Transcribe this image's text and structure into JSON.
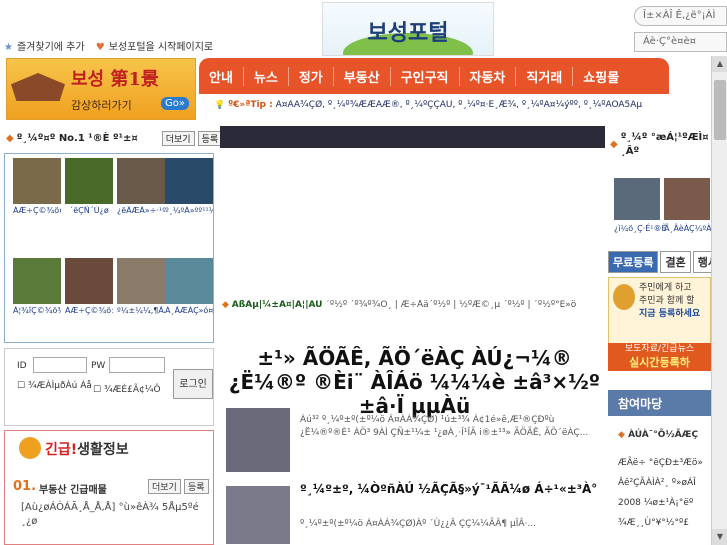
{
  "favorites": {
    "add_favorite": "즐겨찾기에 추가",
    "set_homepage": "보성포털을 시작페이지로"
  },
  "logo": {
    "text": "보성포털"
  },
  "top_right": {
    "box1": "Î±×ÀÎ Ê,¿ë°¡ÀÌ",
    "box2": "Áè·Ç°è¤è¤"
  },
  "banner": {
    "title": "보성 第1景",
    "sub": "감상하러가기",
    "go": "Go»"
  },
  "nav": {
    "items": [
      "안내",
      "뉴스",
      "정가",
      "부동산",
      "구인구직",
      "자동차",
      "직거래",
      "쇼핑몰"
    ]
  },
  "tipbar": {
    "label": "º€»ªTip :",
    "text": "Á¤ÀÃ¾ÇØ, º¸¼º¾ÆÆÀÆ®, º¸¼ºÇÇÀÚ, º¸¼º¤·È¸Æ¾, º¸¼ºÃ¤¼ýºº, º¸¼ºÃÖÃ5Âµ"
  },
  "photo_section": {
    "title": "º¸¼º¤º No.1 ¹®È º¹±¤",
    "more": "더보기",
    "register": "등록",
    "photos": [
      {
        "caption": "ÀÆ÷Ç©¾ö¤ºÀÂ±×Ç©¾ö",
        "color": "#7a6a4a"
      },
      {
        "caption": "´ëÇÑ´Ù¿ø",
        "color": "#4a6a2a"
      },
      {
        "caption": "¿ëÃÆÀ»÷·¹ºÎ",
        "color": "#6a5a4a"
      },
      {
        "caption": "º¸¼ºÀ»ºº¹¹¼ú¹Ù",
        "color": "#2a4a6a"
      },
      {
        "caption": "Á¦¾îÇ©¾ö¾î¾Ñ³,²",
        "color": "#5a7a3a"
      },
      {
        "caption": "ÀÆ÷Ç©¾ö±ÃÀÂÂ³Î",
        "color": "#6a4a3a"
      },
      {
        "caption": "º¼±¼¼,¶ÃÁ¾Í»·Þ¿¬",
        "color": "#8a7a6a"
      },
      {
        "caption": "Á¸ÃÆÀÇ»ó¤º¾",
        "color": "#5a8a9a"
      }
    ]
  },
  "login": {
    "id_label": "ID",
    "pw_label": "PW",
    "login_btn": "로그인",
    "save_id": "¾ÆÀÌµðÀú Àå",
    "save_pw": "¾ÆÈ£Ã¢¼Ô"
  },
  "urgent": {
    "title_red": "긴급!",
    "title_black": "생활정보",
    "num": "01.",
    "item1": "부동산 긴급매물",
    "more": "더보기",
    "register": "등록",
    "item2": "[Aù¿øÁÒÁÃ¸Å_Å,Å] °ù»êÀ¾ 5Åµ5ºé ¸¿ø"
  },
  "notice": {
    "label": "ÃßÃµ|¼±Á¤|Á¦|ÀÛ",
    "text": "´º½º ´º¾º¾Ó¸ | Æ÷Åä´º½º | ½ºÆ©¸µ ´º½º | ´º½º°Ë»ö"
  },
  "headline": {
    "text": "±¹» ÃÖÃÊ, ÃÖ´ëÀÇ ÀÚ¿¬¼® ¿Ë¼®º ®Èi¨ ÀÎÁö ¼¼¼è ±â³×½º ±â·Ï µµÀü"
  },
  "news": [
    {
      "text": "Àú³² º¸¼º±º(±º¼ö Á¤ÀÁ¾ÇØ) ¹ú±³¾ Á¢1é»ê,Æ¹®ÇÐºù ¿Ë¼®º®È¹ ÀÖ³ 9ÀÌ ÇÑ±¹¼± ¹¿øÀ¸·Î¹ÎÃ i®±¹³» ÃÖÃÊ, ÃÖ´ëÀÇ..."
    },
    {
      "text": "º¸¼º±º, ¼ÒºñÀÚ ½ÃÇÃ§»ý¯¹ÃÃ¼ø Á÷¹«±³À°",
      "sub": "º¸¼º±º(±º¼ö Á¤ÀÁ¾ÇØ)Àº ´Ù¿¿Â ÇÇ¼¼ÃÂ¶ µÎÂ·..."
    }
  ],
  "right": {
    "title": "º¸¼º °æÁ¦¹ºÆÌ¤ ¸Âº",
    "caption1": "¿ì¼ö¸Ç·É¹®È",
    "caption2": "Ã¸ÂèÀÇ¼ºÀ",
    "tabs": [
      "무료등록",
      "결혼",
      "행사"
    ],
    "panel_line1": "주민에게 하고",
    "panel_line2": "주민과 함께 할",
    "panel_line3": "지금 등록하세요",
    "panel_btn1": "보도자료/긴급뉴스",
    "panel_btn2": "실시간등록하",
    "section": "참여마당",
    "list": [
      "ÀÚÀ¯°Ô½ÃÆÇ",
      "ÆÃë÷ °ëÇÐ±³Æö»",
      "Âê²ÇÃÀÌÀ²¸ º»øÁÎ",
      "2008 ¼ø±¹À¡°ëº",
      "¾Æ¸¸Ù°¥°½°º£"
    ]
  }
}
